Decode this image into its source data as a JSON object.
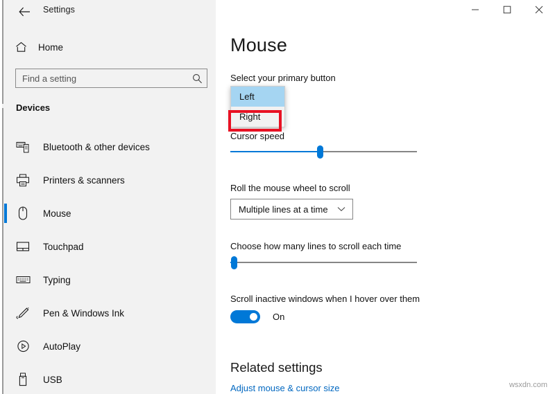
{
  "window": {
    "title": "Settings",
    "back_icon": "back-arrow-icon",
    "controls": {
      "minimize": "minimize-icon",
      "maximize": "maximize-icon",
      "close": "close-icon"
    }
  },
  "sidebar": {
    "home_label": "Home",
    "home_icon": "home-icon",
    "search": {
      "placeholder": "Find a setting",
      "value": "",
      "icon": "search-icon"
    },
    "section_title": "Devices",
    "items": [
      {
        "label": "Bluetooth & other devices",
        "icon": "bluetooth-devices-icon",
        "selected": false
      },
      {
        "label": "Printers & scanners",
        "icon": "printer-icon",
        "selected": false
      },
      {
        "label": "Mouse",
        "icon": "mouse-icon",
        "selected": true
      },
      {
        "label": "Touchpad",
        "icon": "touchpad-icon",
        "selected": false
      },
      {
        "label": "Typing",
        "icon": "keyboard-icon",
        "selected": false
      },
      {
        "label": "Pen & Windows Ink",
        "icon": "pen-icon",
        "selected": false
      },
      {
        "label": "AutoPlay",
        "icon": "autoplay-icon",
        "selected": false
      },
      {
        "label": "USB",
        "icon": "usb-icon",
        "selected": false
      }
    ]
  },
  "main": {
    "page_title": "Mouse",
    "primary_button": {
      "label": "Select your primary button",
      "selected_value": "Left",
      "options": [
        "Left",
        "Right"
      ],
      "highlighted_option": "Left",
      "annotated_option": "Right",
      "annotation_color": "#e81123"
    },
    "cursor_speed": {
      "label": "Cursor speed",
      "value_percent": 48
    },
    "wheel_scroll": {
      "label": "Roll the mouse wheel to scroll",
      "selected_value": "Multiple lines at a time",
      "chevron_icon": "chevron-down-icon"
    },
    "lines_to_scroll": {
      "label": "Choose how many lines to scroll each time",
      "value_percent": 2
    },
    "inactive_scroll": {
      "label": "Scroll inactive windows when I hover over them",
      "state_label": "On",
      "checked": true
    },
    "related": {
      "heading": "Related settings",
      "links": [
        "Adjust mouse & cursor size"
      ]
    }
  },
  "watermark": "wsxdn.com",
  "colors": {
    "accent": "#0078d7",
    "sidebar_bg": "#f2f2f2",
    "highlight": "#a5d5f2",
    "annotation": "#e81123",
    "link": "#0067c0"
  }
}
